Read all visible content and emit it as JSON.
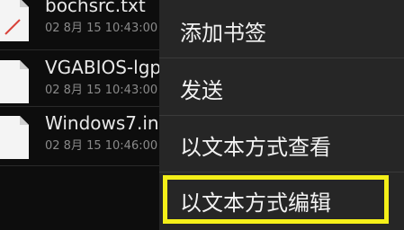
{
  "files": [
    {
      "name": "bochsrc.txt",
      "meta": "02 8月 15 10:43:00",
      "icon": "text-file-icon"
    },
    {
      "name": "VGABIOS-lgp",
      "meta": "02 8月 15 10:43:00",
      "icon": "file-icon"
    },
    {
      "name": "Windows7.in",
      "meta": "02 8月 15 10:46:00",
      "icon": "file-icon"
    }
  ],
  "context_menu": {
    "items": [
      {
        "label": "添加书签"
      },
      {
        "label": "发送"
      },
      {
        "label": "以文本方式查看"
      },
      {
        "label": "以文本方式编辑"
      }
    ],
    "highlight_color": "#f4ef18"
  }
}
